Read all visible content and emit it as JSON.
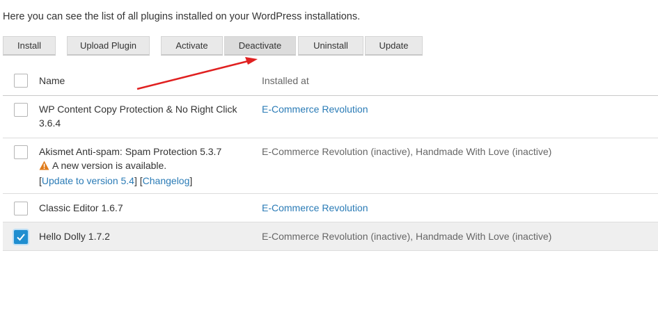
{
  "intro_text": "Here you can see the list of all plugins installed on your WordPress installations.",
  "toolbar": {
    "install": "Install",
    "upload_plugin": "Upload Plugin",
    "activate": "Activate",
    "deactivate": "Deactivate",
    "uninstall": "Uninstall",
    "update": "Update"
  },
  "table": {
    "headers": {
      "name": "Name",
      "installed_at": "Installed at"
    },
    "rows": [
      {
        "name": "WP Content Copy Protection & No Right Click",
        "version": "3.6.4",
        "installed_at": "E-Commerce Revolution",
        "checked": false
      },
      {
        "name": "Akismet Anti-spam: Spam Protection 5.3.7",
        "notice": "A new version is available.",
        "update_link": "Update to version 5.4",
        "changelog_link": "Changelog",
        "installed_at": "E-Commerce Revolution (inactive), Handmade With Love (inactive)",
        "checked": false
      },
      {
        "name": "Classic Editor 1.6.7",
        "installed_at": "E-Commerce Revolution",
        "checked": false
      },
      {
        "name": "Hello Dolly 1.7.2",
        "installed_at": "E-Commerce Revolution (inactive), Handmade With Love (inactive)",
        "checked": true
      }
    ]
  },
  "colors": {
    "link": "#2a7bb6",
    "checkbox_checked": "#1f8ed0",
    "annotation_arrow": "#e02020",
    "warning": "#e07b1a"
  },
  "brackets": {
    "open": "[",
    "close": "]"
  }
}
